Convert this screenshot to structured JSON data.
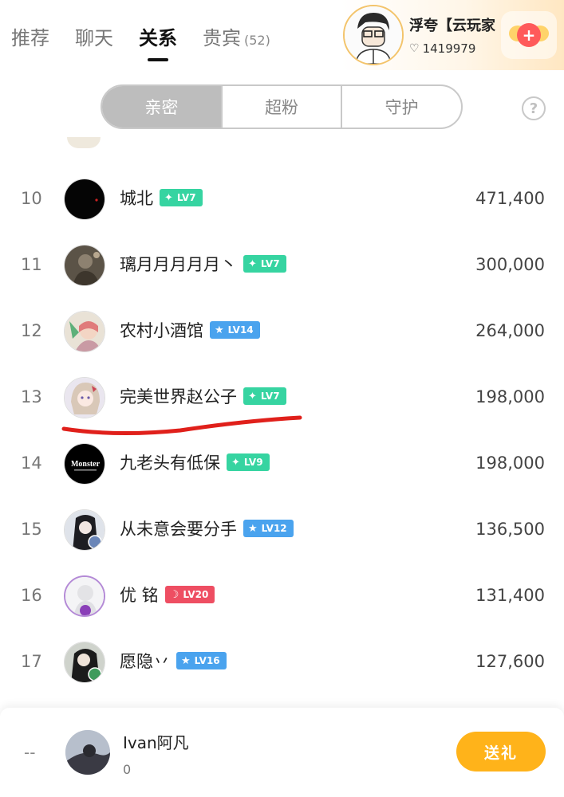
{
  "nav": {
    "tabs": [
      {
        "label": "推荐",
        "active": false
      },
      {
        "label": "聊天",
        "active": false
      },
      {
        "label": "关系",
        "active": true
      },
      {
        "label": "贵宾",
        "active": false,
        "count": "(52)"
      }
    ]
  },
  "host": {
    "name": "浮夸【云玩家",
    "fans": "1419979",
    "heart_icon": "heart-outline-icon",
    "badge_icon": "winged-heart-icon"
  },
  "segments": [
    {
      "label": "亲密",
      "active": true
    },
    {
      "label": "超粉",
      "active": false
    },
    {
      "label": "守护",
      "active": false
    }
  ],
  "help": {
    "label": "?"
  },
  "ranking": [
    {
      "rank": "10",
      "name": "城北",
      "level": "LV7",
      "level_color": "green",
      "level_symbol": "✦",
      "score": "471,400"
    },
    {
      "rank": "11",
      "name": "璃月月月月月丶",
      "level": "LV7",
      "level_color": "green",
      "level_symbol": "✦",
      "score": "300,000"
    },
    {
      "rank": "12",
      "name": "农村小酒馆",
      "level": "LV14",
      "level_color": "blue",
      "level_symbol": "★",
      "score": "264,000"
    },
    {
      "rank": "13",
      "name": "完美世界赵公子",
      "level": "LV7",
      "level_color": "green",
      "level_symbol": "✦",
      "score": "198,000"
    },
    {
      "rank": "14",
      "name": "九老头有低保",
      "level": "LV9",
      "level_color": "green",
      "level_symbol": "✦",
      "score": "198,000"
    },
    {
      "rank": "15",
      "name": "从未意会要分手",
      "level": "LV12",
      "level_color": "blue",
      "level_symbol": "★",
      "score": "136,500"
    },
    {
      "rank": "16",
      "name": "优 铭",
      "level": "LV20",
      "level_color": "red",
      "level_symbol": "☽",
      "score": "131,400"
    },
    {
      "rank": "17",
      "name": "愿隐丷",
      "level": "LV16",
      "level_color": "blue",
      "level_symbol": "★",
      "score": "127,600"
    }
  ],
  "avatar_text": {
    "monster": "Monster"
  },
  "colors": {
    "green_level": "#36d4a1",
    "blue_level": "#4aa3ee",
    "red_level": "#ee4e62",
    "gift_button": "#ffb31a",
    "annotation_underline": "#e0201b"
  },
  "me": {
    "rank": "--",
    "name": "Ivan阿凡",
    "score": "0",
    "gift_label": "送礼"
  }
}
